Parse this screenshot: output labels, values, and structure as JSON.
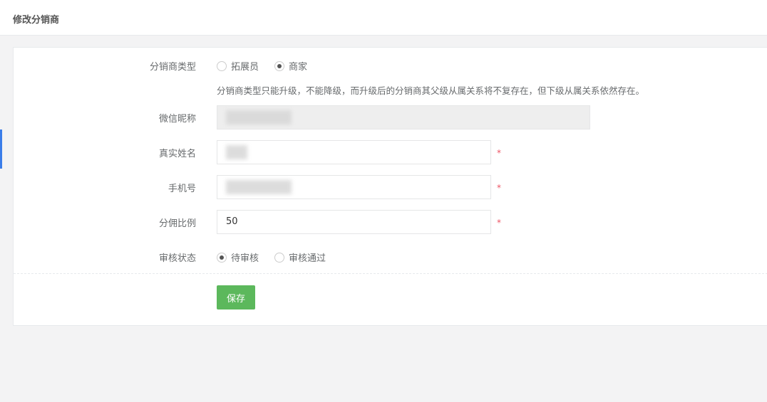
{
  "header": {
    "title": "修改分销商"
  },
  "form": {
    "type_label": "分销商类型",
    "type_options": [
      {
        "label": "拓展员",
        "checked": false
      },
      {
        "label": "商家",
        "checked": true
      }
    ],
    "type_hint": "分销商类型只能升级，不能降级，而升级后的分销商其父级从属关系将不复存在，但下级从属关系依然存在。",
    "nickname_label": "微信昵称",
    "realname_label": "真实姓名",
    "phone_label": "手机号",
    "ratio_label": "分佣比例",
    "ratio_value": "50",
    "required_mark": "*",
    "status_label": "审核状态",
    "status_options": [
      {
        "label": "待审核",
        "checked": true
      },
      {
        "label": "审核通过",
        "checked": false
      }
    ],
    "save_label": "保存"
  }
}
